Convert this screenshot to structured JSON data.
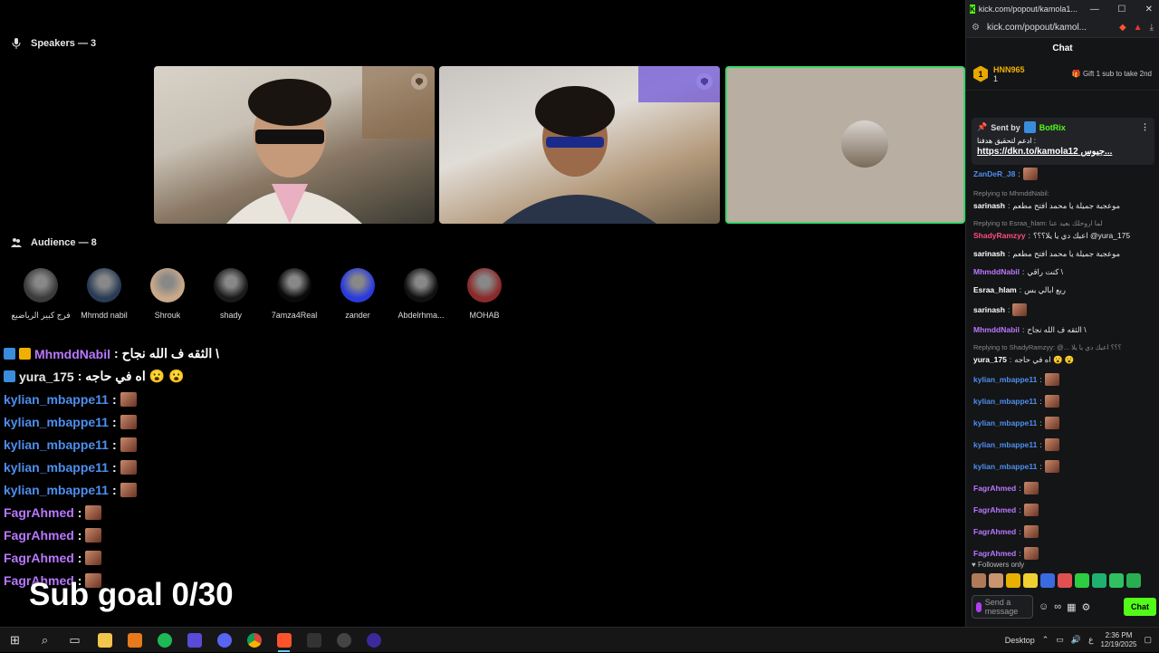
{
  "speakers": {
    "label": "Speakers — 3"
  },
  "audience": {
    "label": "Audience — 8",
    "members": [
      {
        "name": "فرج كبير الرياضيع",
        "color": "#3b3b3b"
      },
      {
        "name": "Mhmdd nabil",
        "color": "#2a3b55"
      },
      {
        "name": "Shrouk",
        "color": "#c9a98a"
      },
      {
        "name": "shady",
        "color": "#1a1a1a"
      },
      {
        "name": "7amza4Real",
        "color": "#0a0a0a"
      },
      {
        "name": "zander",
        "color": "#2a3bdb"
      },
      {
        "name": "Abdelrhma...",
        "color": "#111111"
      },
      {
        "name": "MOHAB",
        "color": "#8a2a2a"
      }
    ]
  },
  "overlay_chat": [
    {
      "user": "MhmddNabil",
      "color": "purple",
      "badges": [
        "vip",
        "crown"
      ],
      "text": ": الثقه ف الله نجاح \\",
      "emotes": 0
    },
    {
      "user": "yura_175",
      "color": "white",
      "badges": [
        "vip"
      ],
      "text": ": اه في حاجه 😮 😮",
      "emotes": 0
    },
    {
      "user": "kylian_mbappe11",
      "color": "blue",
      "badges": [],
      "text": ":",
      "emotes": 1
    },
    {
      "user": "kylian_mbappe11",
      "color": "blue",
      "badges": [],
      "text": ":",
      "emotes": 1
    },
    {
      "user": "kylian_mbappe11",
      "color": "blue",
      "badges": [],
      "text": ":",
      "emotes": 1
    },
    {
      "user": "kylian_mbappe11",
      "color": "blue",
      "badges": [],
      "text": ":",
      "emotes": 1
    },
    {
      "user": "kylian_mbappe11",
      "color": "blue",
      "badges": [],
      "text": ":",
      "emotes": 1
    },
    {
      "user": "FagrAhmed",
      "color": "purple",
      "badges": [],
      "text": ":",
      "emotes": 1
    },
    {
      "user": "FagrAhmed",
      "color": "purple",
      "badges": [],
      "text": ":",
      "emotes": 1
    },
    {
      "user": "FagrAhmed",
      "color": "purple",
      "badges": [],
      "text": ":",
      "emotes": 1
    },
    {
      "user": "FagrAhmed",
      "color": "purple",
      "badges": [],
      "text": ":",
      "emotes": 1
    }
  ],
  "sub_goal": "Sub goal 0/30",
  "popout": {
    "window_title": "kick.com/popout/kamola1...",
    "url": "kick.com/popout/kamol...",
    "chat_title": "Chat",
    "leader": {
      "name": "HNN965",
      "count": "1",
      "rank": "1"
    },
    "gift_text": "Gift 1 sub to take 2nd",
    "pinned": {
      "sent_by": "Sent by",
      "bot": "BotRix",
      "text": "ادعم لتحقيق هدفنا :",
      "link": "https://dkn.to/kamola12 جيوس..."
    },
    "messages": [
      {
        "reply": "",
        "user": "ZanDeR_J8",
        "color": "blue",
        "text": "",
        "emote": true
      },
      {
        "reply": "Replying to MhmddNabil:",
        "user": "sarinash",
        "color": "white",
        "text": "موعجبة جميلة يا محمد افتح مطعم",
        "emote": false
      },
      {
        "reply": "Replying to Esraa_hlam: لما اروحلك بعيد عنا",
        "user": "ShadyRamzyy",
        "color": "pink",
        "text": "اعبك دي يا يلا؟؟؟ @yura_175",
        "emote": false
      },
      {
        "reply": "",
        "user": "sarinash",
        "color": "white",
        "text": "موعجبة جميلة يا محمد افتح مطعم",
        "emote": false
      },
      {
        "reply": "",
        "user": "MhmddNabil",
        "color": "purple",
        "text": "كنت راقي \\",
        "emote": false
      },
      {
        "reply": "",
        "user": "Esraa_hlam",
        "color": "white",
        "text": "ربع ابالي بس",
        "emote": false
      },
      {
        "reply": "",
        "user": "sarinash",
        "color": "white",
        "text": "",
        "emote": true
      },
      {
        "reply": "",
        "user": "MhmddNabil",
        "color": "purple",
        "text": "الثقه ف الله نجاح \\",
        "emote": false
      },
      {
        "reply": "Replying to ShadyRamzyy: @... ؟؟؟ اعبك دي يا يلا",
        "user": "yura_175",
        "color": "white",
        "text": "اه في حاجه 😮 😮",
        "emote": false
      },
      {
        "reply": "",
        "user": "kylian_mbappe11",
        "color": "blue",
        "text": "",
        "emote": true
      },
      {
        "reply": "",
        "user": "kylian_mbappe11",
        "color": "blue",
        "text": "",
        "emote": true
      },
      {
        "reply": "",
        "user": "kylian_mbappe11",
        "color": "blue",
        "text": "",
        "emote": true
      },
      {
        "reply": "",
        "user": "kylian_mbappe11",
        "color": "blue",
        "text": "",
        "emote": true
      },
      {
        "reply": "",
        "user": "kylian_mbappe11",
        "color": "blue",
        "text": "",
        "emote": true
      },
      {
        "reply": "",
        "user": "FagrAhmed",
        "color": "purple",
        "text": "",
        "emote": true
      },
      {
        "reply": "",
        "user": "FagrAhmed",
        "color": "purple",
        "text": "",
        "emote": true
      },
      {
        "reply": "",
        "user": "FagrAhmed",
        "color": "purple",
        "text": "",
        "emote": true
      },
      {
        "reply": "",
        "user": "FagrAhmed",
        "color": "purple",
        "text": "",
        "emote": true
      }
    ],
    "followers_only": "Followers only",
    "input_placeholder": "Send a message",
    "chat_button": "Chat"
  },
  "taskbar": {
    "desktop_label": "Desktop",
    "lang": "ع",
    "time": "2:36 PM",
    "date": "12/19/2025"
  }
}
